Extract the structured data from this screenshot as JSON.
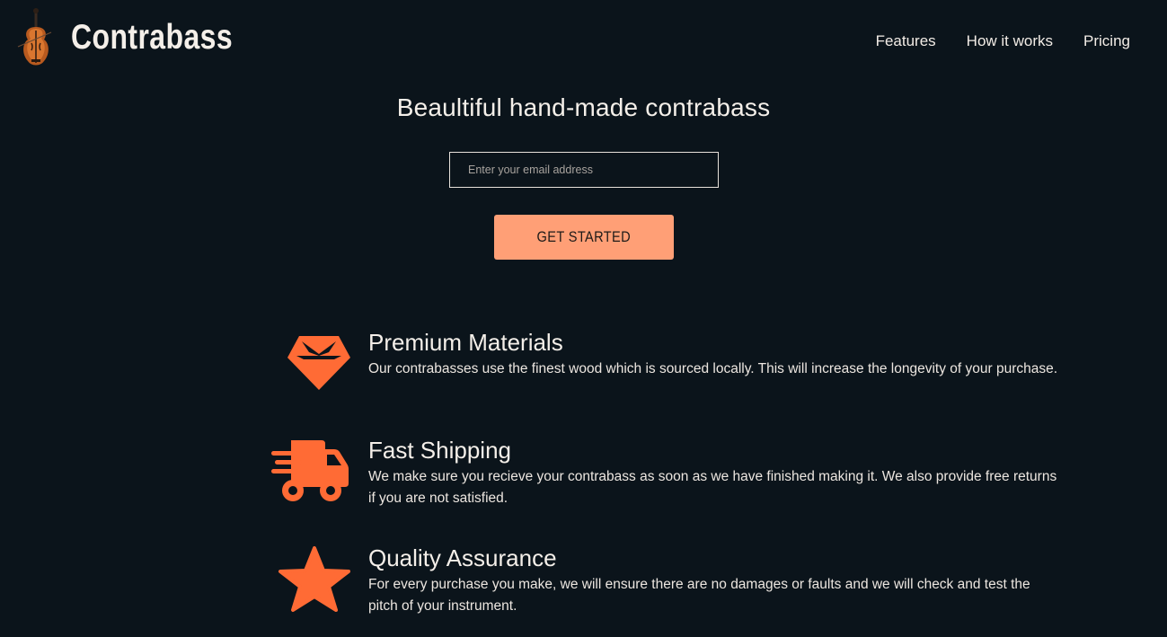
{
  "header": {
    "brand": "Contrabass",
    "nav": [
      "Features",
      "How it works",
      "Pricing"
    ]
  },
  "hero": {
    "title": "Beaultiful hand-made contrabass",
    "email_placeholder": "Enter your email address",
    "cta_label": "GET STARTED"
  },
  "features": [
    {
      "icon": "gem-icon",
      "title": "Premium Materials",
      "description": "Our contrabasses use the finest wood which is sourced locally. This will increase the longevity of your purchase."
    },
    {
      "icon": "truck-fast-icon",
      "title": "Fast Shipping",
      "description": "We make sure you recieve your contrabass as soon as we have finished making it. We also provide free returns if you are not satisfied."
    },
    {
      "icon": "star-icon",
      "title": "Quality Assurance",
      "description": "For every purchase you make, we will ensure there are no damages or faults and we will check and test the pitch of your instrument."
    }
  ],
  "colors": {
    "background": "#0b141b",
    "accent": "#ff9f76",
    "icon": "#ff6b35",
    "text": "#f2ece6"
  }
}
